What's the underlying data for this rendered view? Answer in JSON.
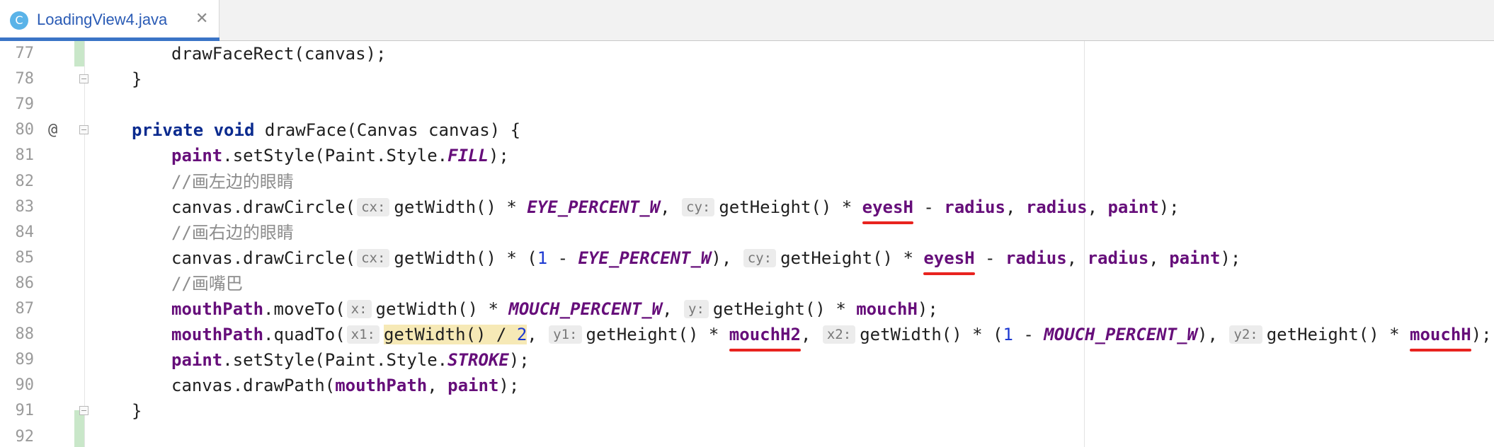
{
  "tab": {
    "icon_letter": "C",
    "file_name": "LoadingView4.java",
    "close_glyph": "✕"
  },
  "gutter": {
    "override_marker": "@"
  },
  "lines": [
    {
      "number": "77",
      "segments": [
        {
          "t": "drawFaceRect(canvas);",
          "c": "txt"
        }
      ]
    },
    {
      "number": "78",
      "segments": [
        {
          "t": "}",
          "c": "txt"
        }
      ]
    },
    {
      "number": "79",
      "segments": []
    },
    {
      "number": "80",
      "segments": [
        {
          "t": "private",
          "c": "kw"
        },
        {
          "t": " ",
          "c": "txt"
        },
        {
          "t": "void",
          "c": "kw"
        },
        {
          "t": " drawFace(Canvas canvas) {",
          "c": "txt"
        }
      ]
    },
    {
      "number": "81",
      "segments": [
        {
          "t": "paint",
          "c": "fld"
        },
        {
          "t": ".setStyle(Paint.Style.",
          "c": "txt"
        },
        {
          "t": "FILL",
          "c": "cst"
        },
        {
          "t": ");",
          "c": "txt"
        }
      ]
    },
    {
      "number": "82",
      "segments": [
        {
          "t": "//画左边的眼睛",
          "c": "cmt"
        }
      ]
    },
    {
      "number": "83",
      "segments": [
        {
          "t": "canvas.drawCircle(",
          "c": "txt"
        },
        {
          "t": "cx:",
          "c": "hint"
        },
        {
          "t": "getWidth() * ",
          "c": "txt"
        },
        {
          "t": "EYE_PERCENT_W",
          "c": "cst"
        },
        {
          "t": ", ",
          "c": "txt"
        },
        {
          "t": "cy:",
          "c": "hint"
        },
        {
          "t": "getHeight() * ",
          "c": "txt"
        },
        {
          "t": "eyesH",
          "c": "fld ul"
        },
        {
          "t": " - ",
          "c": "txt"
        },
        {
          "t": "radius",
          "c": "fld"
        },
        {
          "t": ", ",
          "c": "txt"
        },
        {
          "t": "radius",
          "c": "fld"
        },
        {
          "t": ", ",
          "c": "txt"
        },
        {
          "t": "paint",
          "c": "fld"
        },
        {
          "t": ");",
          "c": "txt"
        }
      ]
    },
    {
      "number": "84",
      "segments": [
        {
          "t": "//画右边的眼睛",
          "c": "cmt"
        }
      ]
    },
    {
      "number": "85",
      "segments": [
        {
          "t": "canvas.drawCircle(",
          "c": "txt"
        },
        {
          "t": "cx:",
          "c": "hint"
        },
        {
          "t": "getWidth() * (",
          "c": "txt"
        },
        {
          "t": "1",
          "c": "num"
        },
        {
          "t": " - ",
          "c": "txt"
        },
        {
          "t": "EYE_PERCENT_W",
          "c": "cst"
        },
        {
          "t": "), ",
          "c": "txt"
        },
        {
          "t": "cy:",
          "c": "hint"
        },
        {
          "t": "getHeight() * ",
          "c": "txt"
        },
        {
          "t": "eyesH",
          "c": "fld ul"
        },
        {
          "t": " - ",
          "c": "txt"
        },
        {
          "t": "radius",
          "c": "fld"
        },
        {
          "t": ", ",
          "c": "txt"
        },
        {
          "t": "radius",
          "c": "fld"
        },
        {
          "t": ", ",
          "c": "txt"
        },
        {
          "t": "paint",
          "c": "fld"
        },
        {
          "t": ");",
          "c": "txt"
        }
      ]
    },
    {
      "number": "86",
      "segments": [
        {
          "t": "//画嘴巴",
          "c": "cmt"
        }
      ]
    },
    {
      "number": "87",
      "segments": [
        {
          "t": "mouthPath",
          "c": "fld"
        },
        {
          "t": ".moveTo(",
          "c": "txt"
        },
        {
          "t": "x:",
          "c": "hint"
        },
        {
          "t": "getWidth() * ",
          "c": "txt"
        },
        {
          "t": "MOUCH_PERCENT_W",
          "c": "cst"
        },
        {
          "t": ", ",
          "c": "txt"
        },
        {
          "t": "y:",
          "c": "hint"
        },
        {
          "t": "getHeight() * ",
          "c": "txt"
        },
        {
          "t": "mouchH",
          "c": "fld"
        },
        {
          "t": ");",
          "c": "txt"
        }
      ]
    },
    {
      "number": "88",
      "segments": [
        {
          "t": "mouthPath",
          "c": "fld"
        },
        {
          "t": ".quadTo(",
          "c": "txt"
        },
        {
          "t": "x1:",
          "c": "hint"
        },
        {
          "t": "getWidth() / ",
          "c": "hl"
        },
        {
          "t": "2",
          "c": "num hl"
        },
        {
          "t": ", ",
          "c": "txt"
        },
        {
          "t": "y1:",
          "c": "hint"
        },
        {
          "t": "getHeight() * ",
          "c": "txt"
        },
        {
          "t": "mouchH2",
          "c": "fld ul"
        },
        {
          "t": ", ",
          "c": "txt"
        },
        {
          "t": "x2:",
          "c": "hint"
        },
        {
          "t": "getWidth() * (",
          "c": "txt"
        },
        {
          "t": "1",
          "c": "num"
        },
        {
          "t": " - ",
          "c": "txt"
        },
        {
          "t": "MOUCH_PERCENT_W",
          "c": "cst"
        },
        {
          "t": "), ",
          "c": "txt"
        },
        {
          "t": "y2:",
          "c": "hint"
        },
        {
          "t": "getHeight() * ",
          "c": "txt"
        },
        {
          "t": "mouchH",
          "c": "fld ul"
        },
        {
          "t": ");",
          "c": "txt"
        }
      ]
    },
    {
      "number": "89",
      "segments": [
        {
          "t": "paint",
          "c": "fld"
        },
        {
          "t": ".setStyle(Paint.Style.",
          "c": "txt"
        },
        {
          "t": "STROKE",
          "c": "cst"
        },
        {
          "t": ");",
          "c": "txt"
        }
      ]
    },
    {
      "number": "90",
      "segments": [
        {
          "t": "canvas.drawPath(",
          "c": "txt"
        },
        {
          "t": "mouthPath",
          "c": "fld"
        },
        {
          "t": ", ",
          "c": "txt"
        },
        {
          "t": "paint",
          "c": "fld"
        },
        {
          "t": ");",
          "c": "txt"
        }
      ]
    },
    {
      "number": "91",
      "segments": [
        {
          "t": "}",
          "c": "txt"
        }
      ]
    },
    {
      "number": "92",
      "segments": []
    }
  ]
}
